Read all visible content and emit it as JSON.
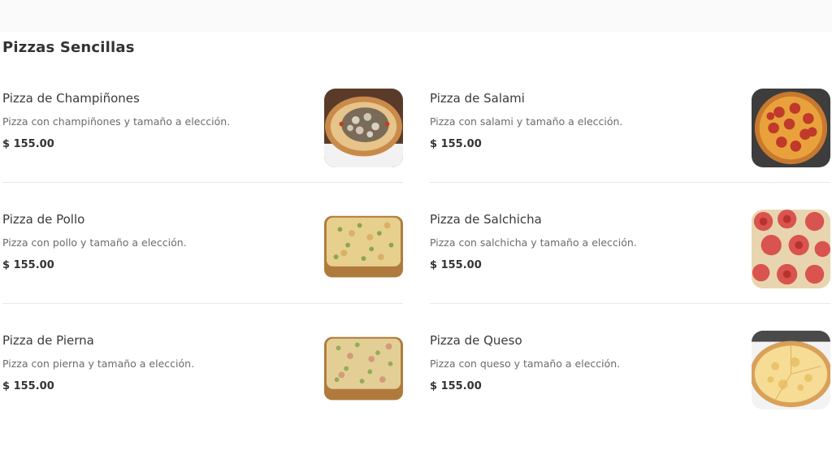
{
  "section": {
    "title": "Pizzas Sencillas"
  },
  "items": [
    {
      "name": "Pizza de Champiñones",
      "description": "Pizza con champiñones y tamaño a elección.",
      "price": "$ 155.00",
      "image_icon": "mushroom-pizza-photo"
    },
    {
      "name": "Pizza de Salami",
      "description": "Pizza con salami y tamaño a elección.",
      "price": "$ 155.00",
      "image_icon": "salami-pizza-photo"
    },
    {
      "name": "Pizza de Pollo",
      "description": "Pizza con pollo y tamaño a elección.",
      "price": "$ 155.00",
      "image_icon": "chicken-pizza-photo"
    },
    {
      "name": "Pizza de Salchicha",
      "description": "Pizza con salchicha y tamaño a elección.",
      "price": "$ 155.00",
      "image_icon": "sausage-pizza-photo"
    },
    {
      "name": "Pizza de Pierna",
      "description": "Pizza con pierna y tamaño a elección.",
      "price": "$ 155.00",
      "image_icon": "ham-pizza-photo"
    },
    {
      "name": "Pizza de Queso",
      "description": "Pizza con queso y tamaño a elección.",
      "price": "$ 155.00",
      "image_icon": "cheese-pizza-photo"
    }
  ]
}
